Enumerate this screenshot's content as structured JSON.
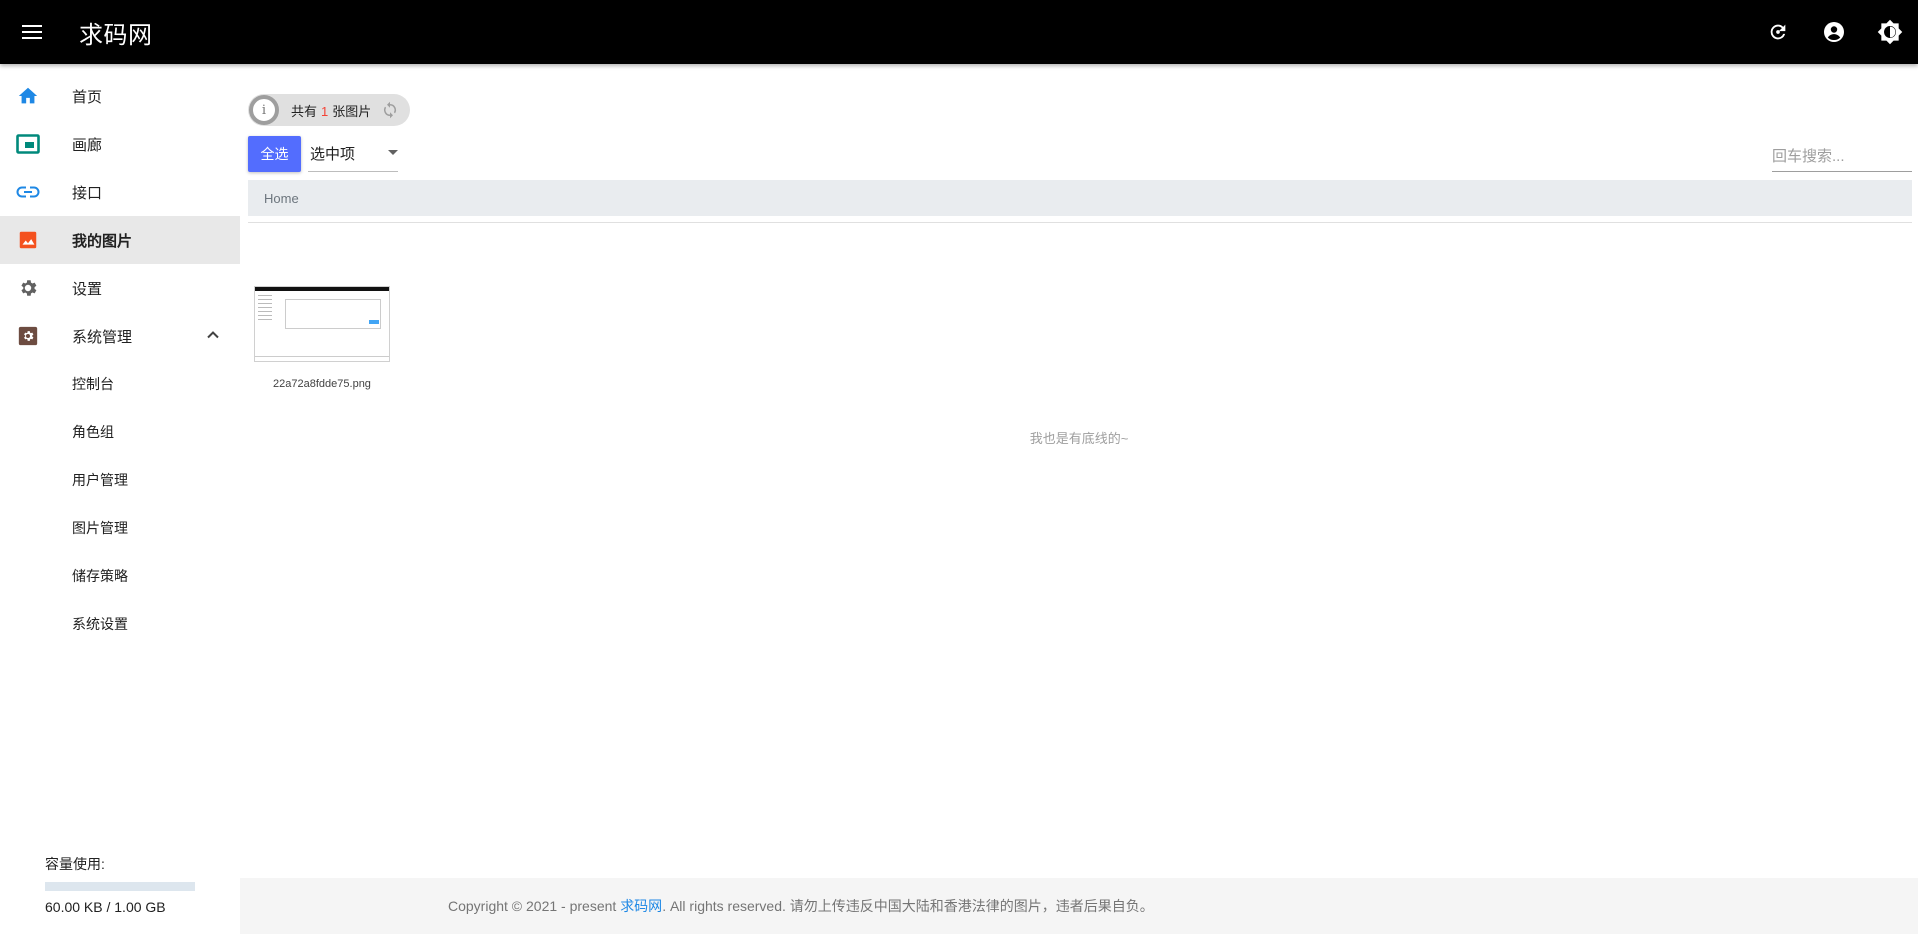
{
  "app": {
    "title": "求码网"
  },
  "colors": {
    "appbar": "#000000",
    "accent": "#536dfe",
    "active_nav_icon": "#f4511e"
  },
  "sidebar": {
    "items": [
      {
        "label": "首页",
        "icon": "home-icon"
      },
      {
        "label": "画廊",
        "icon": "gallery-icon"
      },
      {
        "label": "接口",
        "icon": "link-icon"
      },
      {
        "label": "我的图片",
        "icon": "image-icon",
        "active": true
      },
      {
        "label": "设置",
        "icon": "settings-icon"
      },
      {
        "label": "系统管理",
        "icon": "admin-settings-icon",
        "expanded": true
      }
    ],
    "sub_items": [
      "控制台",
      "角色组",
      "用户管理",
      "图片管理",
      "储存策略",
      "系统设置"
    ],
    "capacity": {
      "title": "容量使用:",
      "used_fraction": 6e-05,
      "text": "60.00 KB / 1.00 GB"
    }
  },
  "main": {
    "chip": {
      "prefix": "共有",
      "count": "1",
      "suffix": "张图片"
    },
    "select_all_label": "全选",
    "selected_dropdown": "选中项",
    "search_placeholder": "回车搜索...",
    "breadcrumb": [
      "Home"
    ],
    "files": [
      {
        "name": "22a72a8fdde75.png"
      }
    ],
    "end_text": "我也是有底线的~"
  },
  "footer": {
    "prefix": "Copyright © 2021 - present ",
    "link": "求码网",
    "suffix": ". All rights reserved. 请勿上传违反中国大陆和香港法律的图片，违者后果自负。"
  }
}
